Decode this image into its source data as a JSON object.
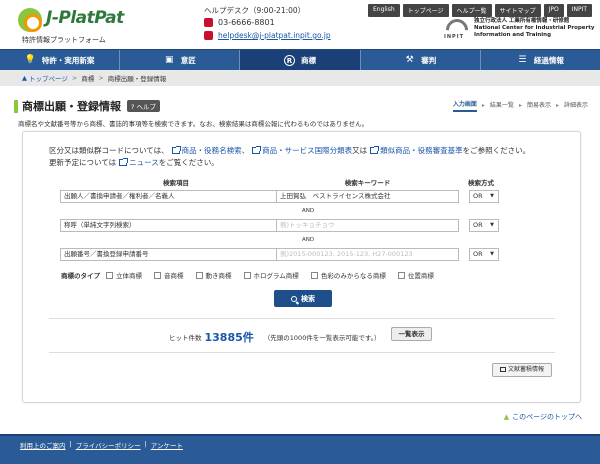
{
  "header": {
    "logo_name": "J-PlatPat",
    "logo_sub": "特許情報プラットフォーム",
    "helpdesk_title": "ヘルプデスク（9:00-21:00）",
    "helpdesk_tel": "03-6666-8801",
    "helpdesk_mail": "helpdesk@j-platpat.inpit.go.jp",
    "top_links": [
      "English",
      "トップページ",
      "ヘルプ一覧",
      "サイトマップ",
      "JPO",
      "INPIT"
    ],
    "inpit_label": "INPIT",
    "inpit_line1": "独立行政法人 工業所有権情報・研修館",
    "inpit_line2": "National Center for Industrial Property",
    "inpit_line3": "Information and Training"
  },
  "nav": {
    "items": [
      {
        "label": "特許・実用新案",
        "icon": "lightbulb-icon"
      },
      {
        "label": "意匠",
        "icon": "design-icon"
      },
      {
        "label": "商標",
        "icon": "registered-icon"
      },
      {
        "label": "審判",
        "icon": "gavel-icon"
      },
      {
        "label": "経過情報",
        "icon": "list-icon"
      }
    ],
    "active_index": 2
  },
  "breadcrumb": {
    "home": "トップページ",
    "items": [
      "商標",
      "商標出願・登録情報"
    ]
  },
  "page": {
    "title": "商標出願・登録情報",
    "help_label": "ヘルプ",
    "steps": [
      "入力画面",
      "結果一覧",
      "簡易表示",
      "詳細表示"
    ],
    "description": "商標名や文献番号等から商標、書誌的事項等を検索できます。なお、検索結果は商標公報に代わるものではありません。"
  },
  "panel": {
    "info1_prefix": "区分又は類似群コードについては、",
    "info1_link1": "商品・役務名検索",
    "info1_sep1": "、",
    "info1_link2": "商品・サービス国際分類表",
    "info1_sep2": "又は",
    "info1_link3": "類似商品・役務審査基準",
    "info1_suffix": "をご参照ください。",
    "info2_prefix": "更新予定については",
    "info2_link": "ニュース",
    "info2_suffix": "をご覧ください。",
    "col_item": "検索項目",
    "col_keyword": "検索キーワード",
    "col_method": "検索方式",
    "rows": [
      {
        "item": "出願人／書換申請者／権利者／名義人",
        "keyword": "上田賀弘　ベストライセンス株式会社",
        "placeholder": "",
        "method": "OR"
      },
      {
        "item": "称呼（単純文字列検索）",
        "keyword": "",
        "placeholder": "例)トッキョチョウ",
        "method": "OR"
      },
      {
        "item": "出願番号／書換登録申請番号",
        "keyword": "",
        "placeholder": "例)2015-000123, 2015-123, H27-000123",
        "method": "OR"
      }
    ],
    "and_label": "AND",
    "types_label": "商標のタイプ",
    "types": [
      "立体商標",
      "音商標",
      "動き商標",
      "ホログラム商標",
      "色彩のみからなる商標",
      "位置商標"
    ],
    "search_label": "検索",
    "hits_label": "ヒット件数",
    "hits_count": "13885件",
    "hits_note": "（先頭の1000件を一覧表示可能です。）",
    "list_label": "一覧表示",
    "saved_label": "文献蓄積情報"
  },
  "to_top": "このページのトップへ",
  "footer": {
    "links": [
      "利用上のご案内",
      "プライバシーポリシー",
      "アンケート"
    ]
  },
  "colors": {
    "nav": "#2a5b97",
    "accent_green": "#8cc63f",
    "link": "#1a56a8"
  }
}
